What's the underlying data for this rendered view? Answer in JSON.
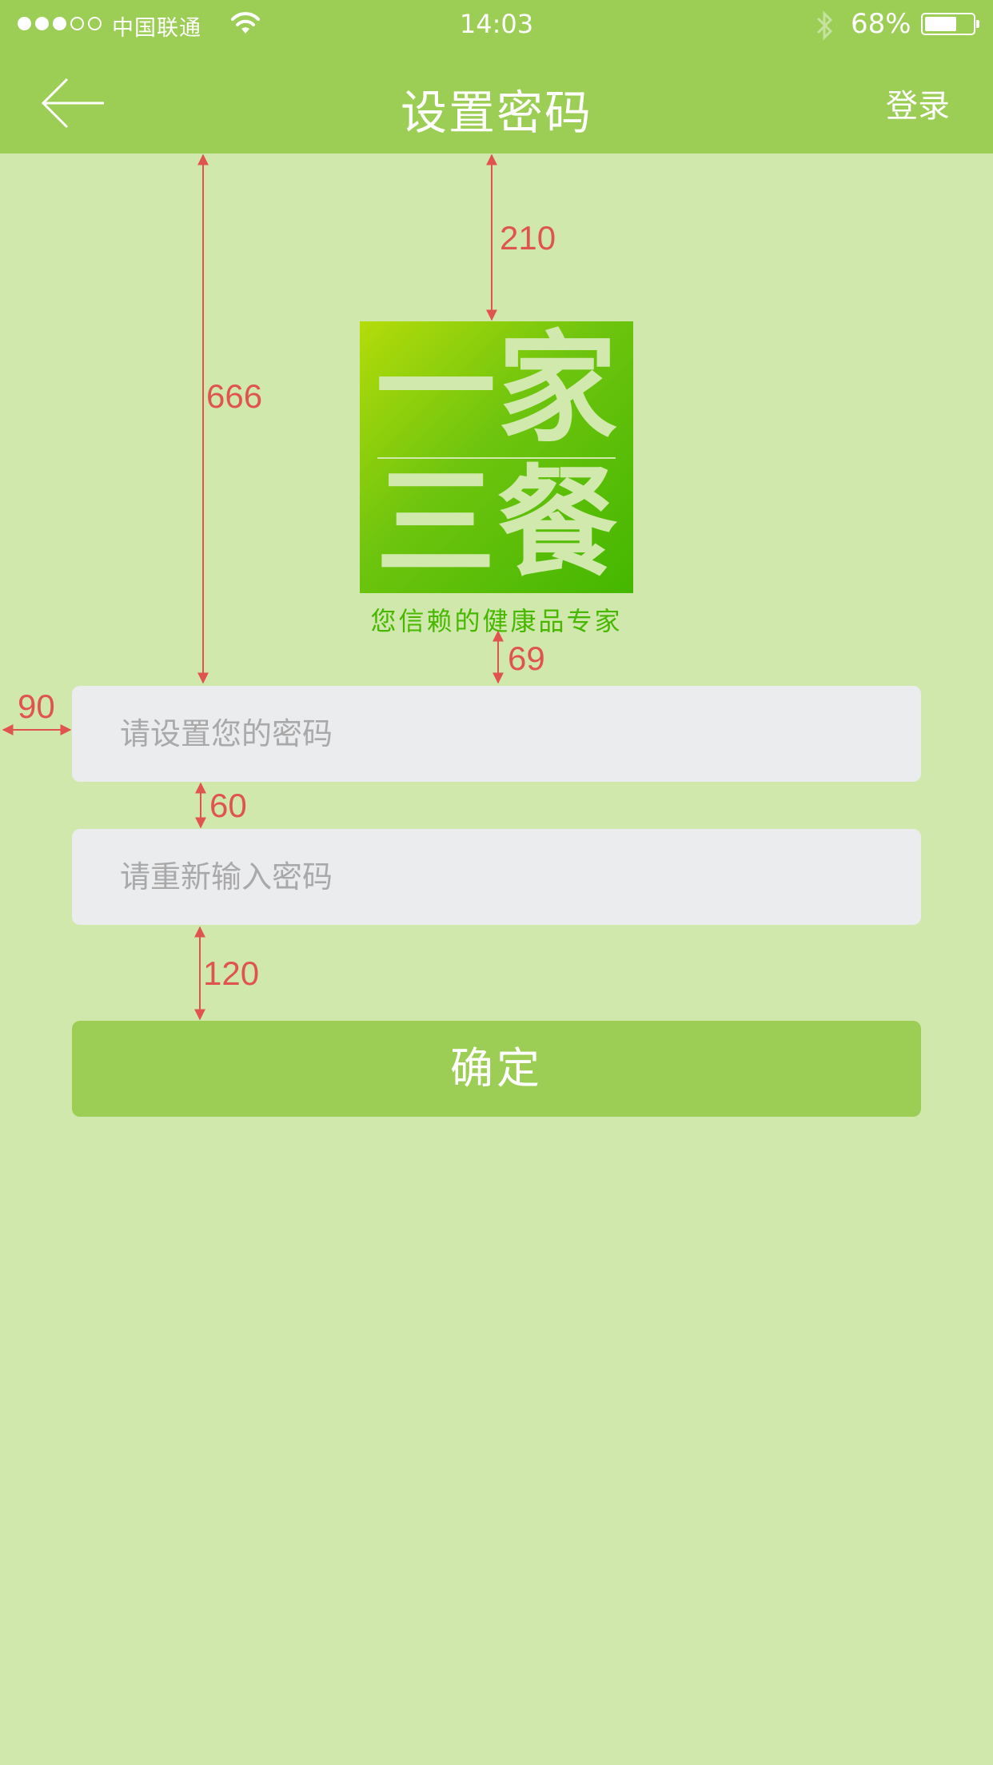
{
  "status_bar": {
    "signal_dots": [
      true,
      true,
      true,
      false,
      false
    ],
    "carrier": "中国联通",
    "time": "14:03",
    "battery_percent_text": "68%",
    "battery_level": 0.68
  },
  "nav": {
    "title": "设置密码",
    "right_action": "登录"
  },
  "logo": {
    "line1": [
      "一",
      "家"
    ],
    "line2": [
      "三",
      "餐"
    ],
    "tagline": "您信赖的健康品专家"
  },
  "form": {
    "password_placeholder": "请设置您的密码",
    "confirm_placeholder": "请重新输入密码",
    "submit_label": "确定"
  },
  "annotations": {
    "logo_top_gap": "210",
    "field_top_gap": "666",
    "logo_field_gap": "69",
    "field_left_margin": "90",
    "field_gap": "60",
    "button_gap": "120"
  },
  "colors": {
    "nav_bar": "#9ccd54",
    "background": "#d0e8ac",
    "field": "#ebecee",
    "annotation": "#e0544e",
    "logo_green": "#44b700"
  }
}
